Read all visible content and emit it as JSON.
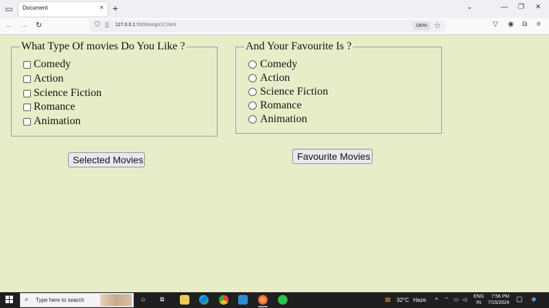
{
  "browser": {
    "tab_title": "Document",
    "tab_close": "×",
    "new_tab": "+",
    "url_host": "127.0.0.1",
    "url_rest": ":5500/asign12.html",
    "zoom": "180%"
  },
  "form": {
    "checkbox_legend": "What Type Of movies Do You Like ?",
    "checkbox_options": [
      "Comedy",
      "Action",
      "Science Fiction",
      "Romance",
      "Animation"
    ],
    "radio_legend": "And Your Favourite Is ?",
    "radio_options": [
      "Comedy",
      "Action",
      "Science Fiction",
      "Romance",
      "Animation"
    ],
    "selected_button": "Selected Movies",
    "favourite_button": "Favourite Movies"
  },
  "taskbar": {
    "search_placeholder": "Type here to search",
    "temperature": "32°C",
    "weather": "Haze",
    "lang_top": "ENG",
    "lang_bottom": "IN",
    "time": "7:56 PM",
    "date": "7/15/2024"
  },
  "colors": {
    "page_background": "#e9ecc8",
    "taskbar": "#1f1f1f"
  }
}
